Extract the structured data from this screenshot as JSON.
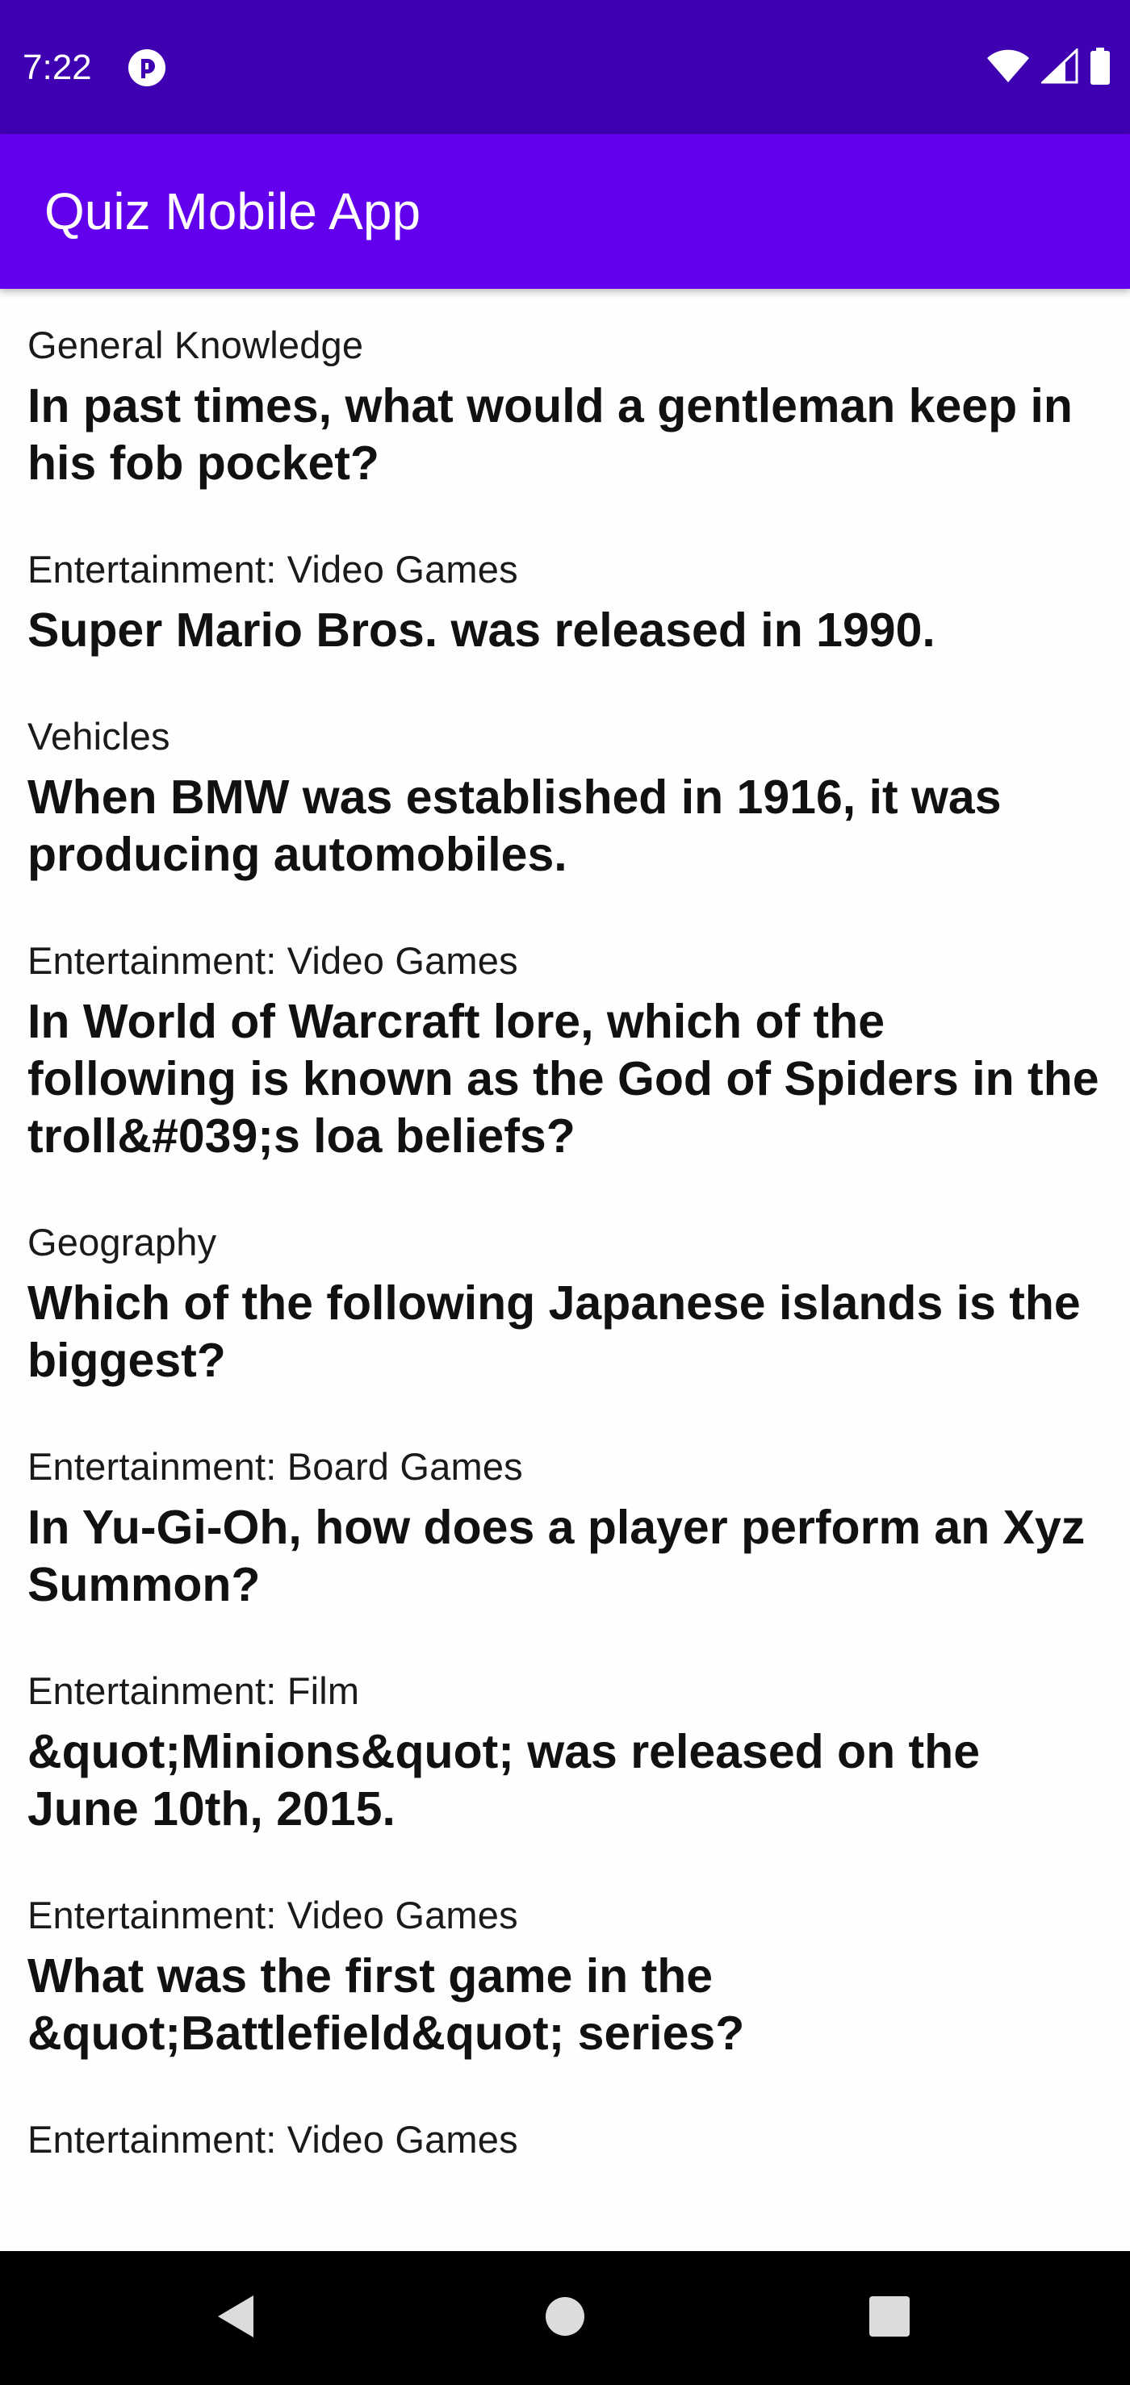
{
  "status_bar": {
    "time": "7:22",
    "icons": [
      "app-notification-icon",
      "wifi-icon",
      "cellular-signal-icon",
      "battery-icon"
    ]
  },
  "app_bar": {
    "title": "Quiz Mobile App"
  },
  "questions": [
    {
      "category": "General Knowledge",
      "question": "In past times, what would a gentleman keep in his fob pocket?"
    },
    {
      "category": "Entertainment: Video Games",
      "question": "Super Mario Bros. was released in 1990."
    },
    {
      "category": "Vehicles",
      "question": "When BMW was established in 1916, it was producing automobiles."
    },
    {
      "category": "Entertainment: Video Games",
      "question": "In World of Warcraft lore, which of the following is known as the God of Spiders in the troll&#039;s loa beliefs?"
    },
    {
      "category": "Geography",
      "question": "Which of the following Japanese islands is the biggest?"
    },
    {
      "category": "Entertainment: Board Games",
      "question": "In Yu-Gi-Oh, how does a player perform an Xyz Summon?"
    },
    {
      "category": "Entertainment: Film",
      "question": "&quot;Minions&quot; was released on the June 10th, 2015."
    },
    {
      "category": "Entertainment: Video Games",
      "question": "What was the first game in the &quot;Battlefield&quot; series?"
    },
    {
      "category": "Entertainment: Video Games",
      "question": ""
    }
  ],
  "nav_bar": {
    "icons": [
      "back-icon",
      "home-icon",
      "recents-icon"
    ]
  },
  "colors": {
    "status_bar": "#3f00b1",
    "app_bar": "#6200ed",
    "background": "#fefefe",
    "nav_bar": "#000000"
  }
}
